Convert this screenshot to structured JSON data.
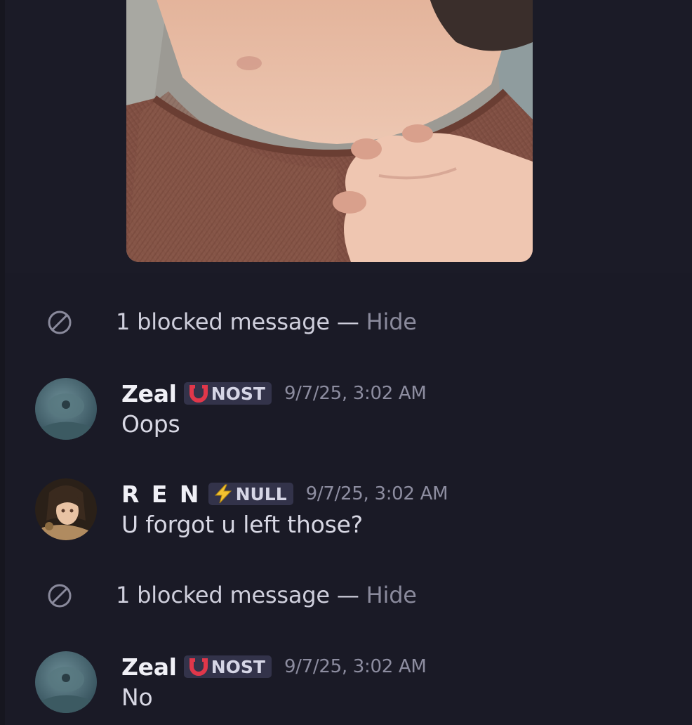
{
  "colors": {
    "background": "#1a1a26",
    "tag_background": "#33334a",
    "hide_link": "#8a8a9c",
    "nost_icon": "#e0374a",
    "null_icon": "#f2c230"
  },
  "attachment": {
    "icon": "photo-attachment"
  },
  "blocked_notices": [
    {
      "text": "1 blocked message — ",
      "hide_label": "Hide",
      "icon": "blocked-icon"
    },
    {
      "text": "1 blocked message — ",
      "hide_label": "Hide",
      "icon": "blocked-icon"
    }
  ],
  "messages": [
    {
      "username": "Zeal",
      "tag": "NOST",
      "tag_icon": "horseshoe-icon",
      "timestamp": "9/7/25, 3:02 AM",
      "text": "Oops"
    },
    {
      "username": "R E N",
      "tag": "NULL",
      "tag_icon": "lightning-icon",
      "timestamp": "9/7/25, 3:02 AM",
      "text": "U forgot u left those?"
    },
    {
      "username": "Zeal",
      "tag": "NOST",
      "tag_icon": "horseshoe-icon",
      "timestamp": "9/7/25, 3:02 AM",
      "text": "No"
    }
  ]
}
